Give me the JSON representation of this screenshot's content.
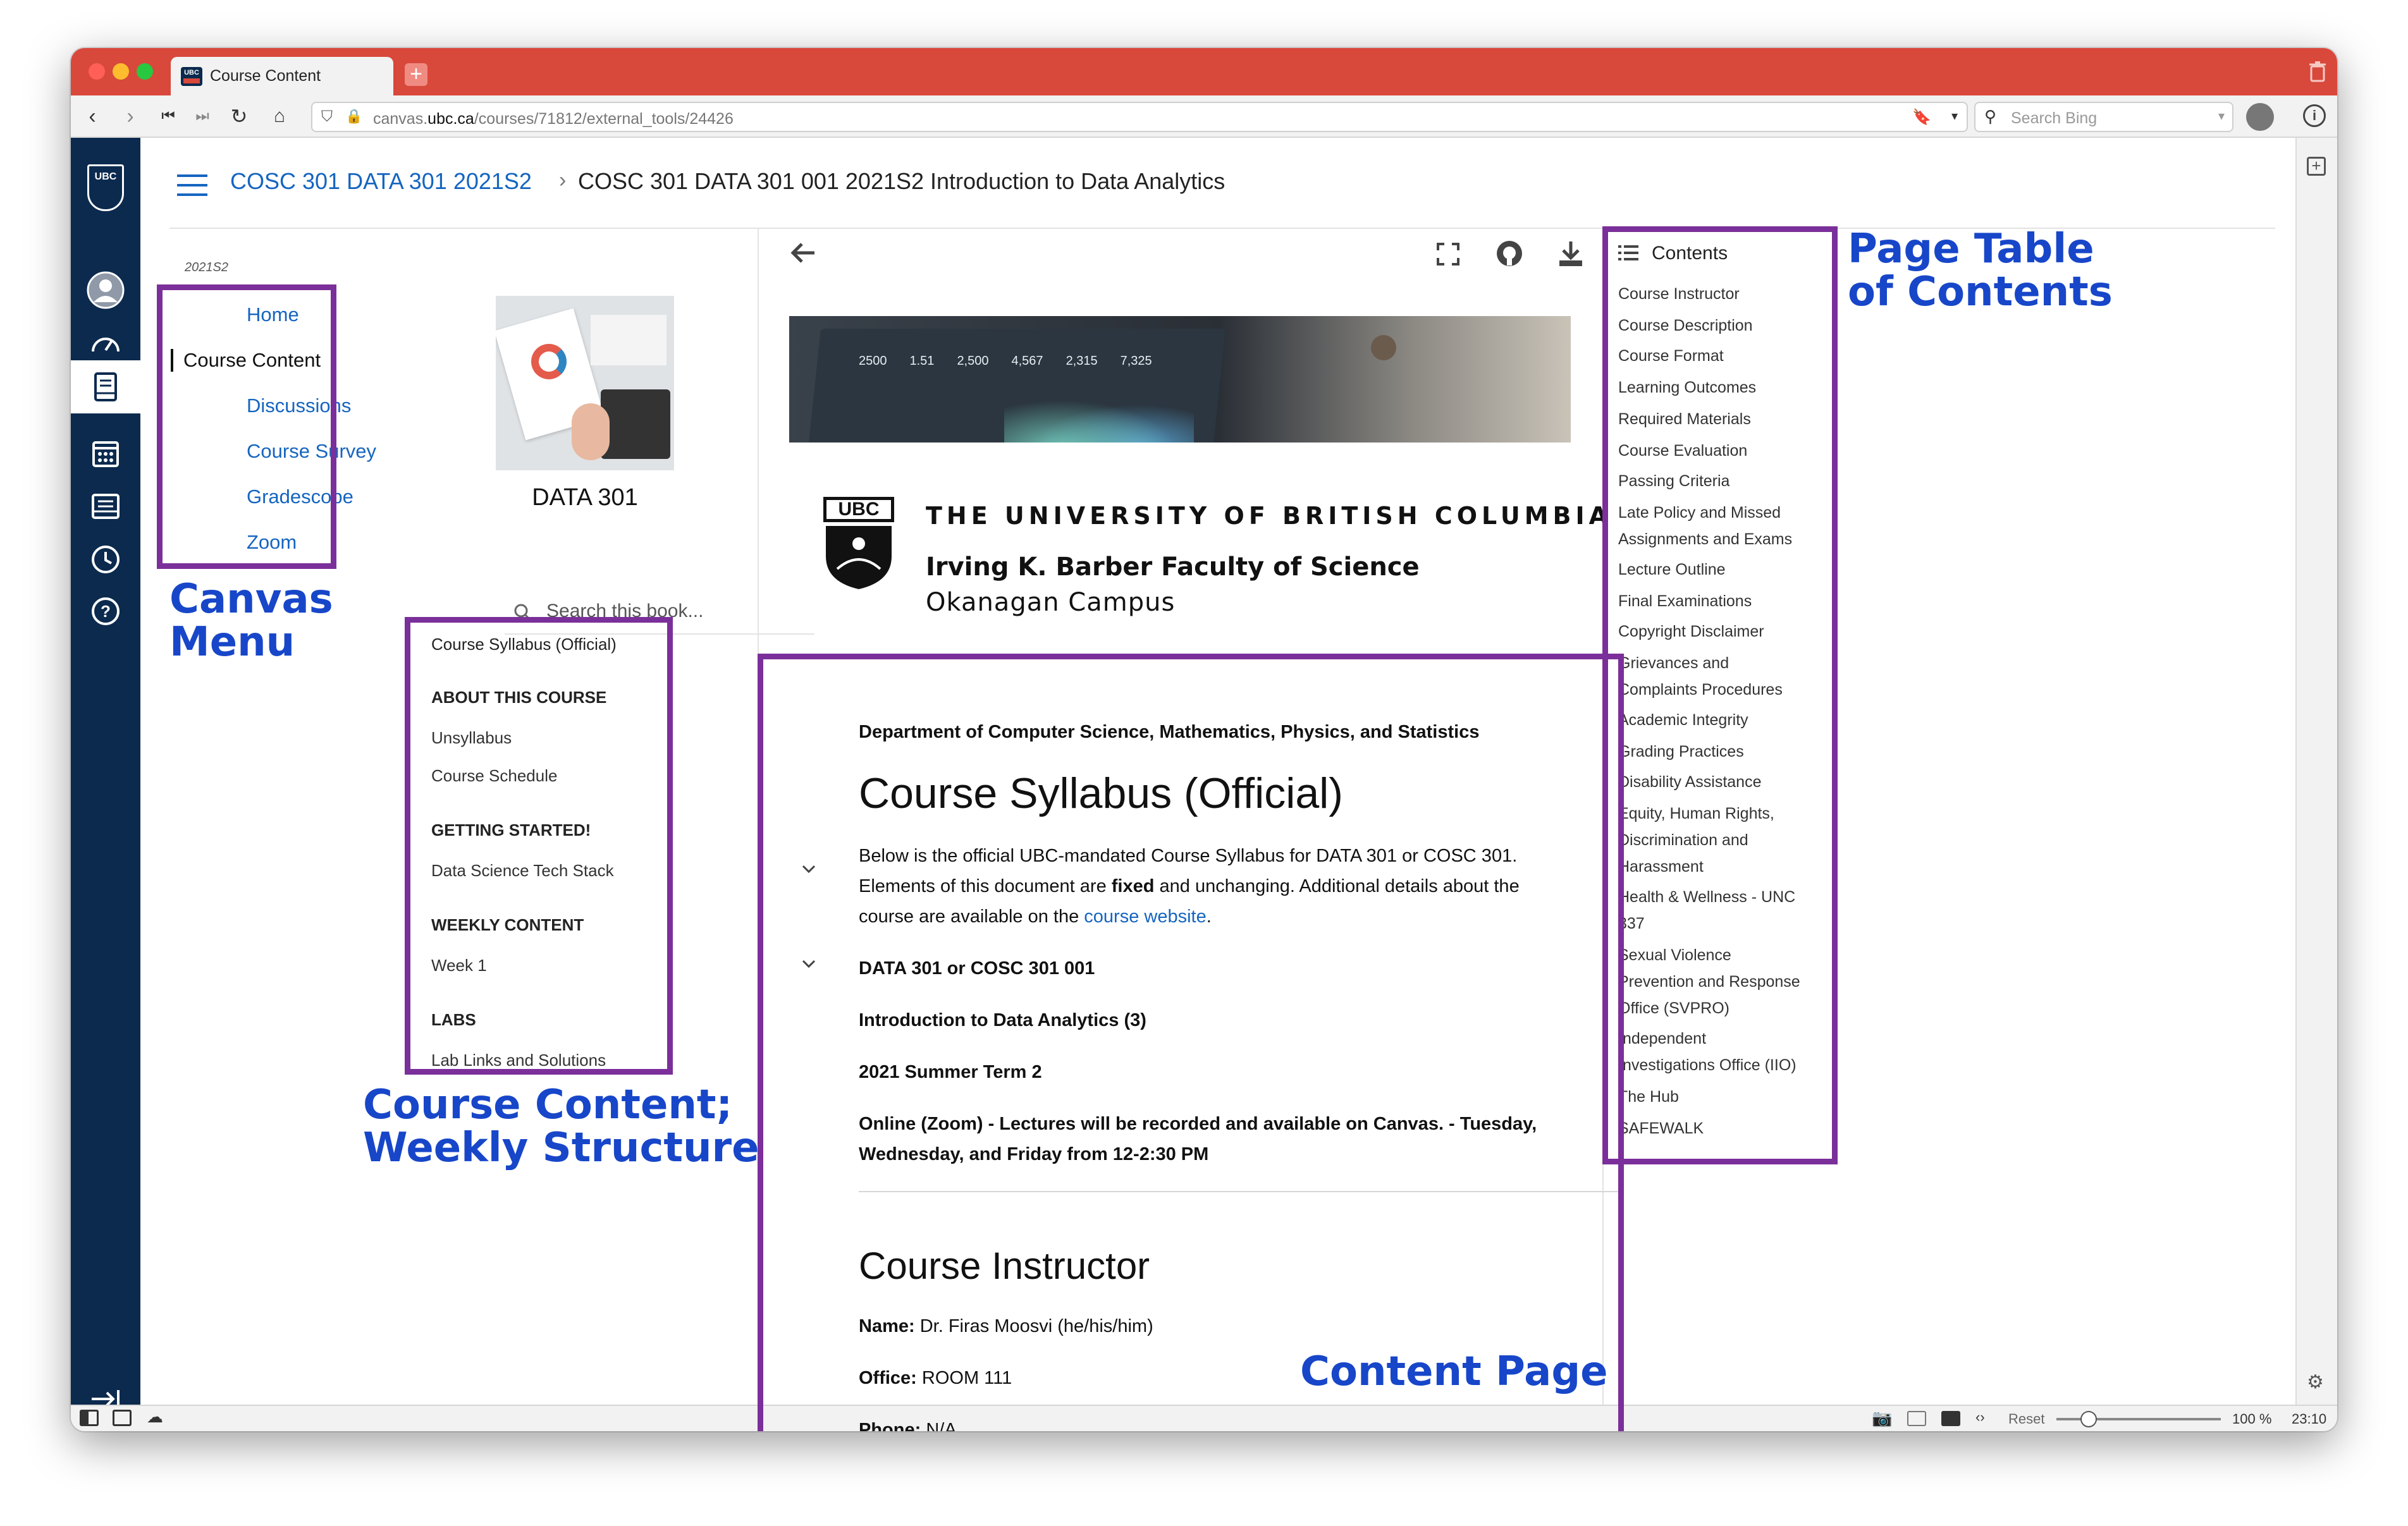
{
  "browser": {
    "tab_title": "Course Content",
    "url_prefix": "canvas.",
    "url_domain": "ubc.ca",
    "url_path": "/courses/71812/external_tools/24426",
    "search_placeholder": "Search Bing",
    "zoom": "100 %",
    "reset_label": "Reset",
    "clock": "23:10",
    "traffic_colors": [
      "#ff5f57",
      "#febc2e",
      "#28c840"
    ],
    "accent": "#d8483b"
  },
  "canvas": {
    "nav_color": "#0b2a4e",
    "logo_text": "UBC",
    "breadcrumb_course": "COSC 301 DATA 301 2021S2",
    "breadcrumb_separator": "›",
    "breadcrumb_page": "COSC 301 DATA 301 001 2021S2 Introduction to Data Analytics",
    "term": "2021S2",
    "menu": [
      "Home",
      "Course Content",
      "Discussions",
      "Course Survey",
      "Gradescope",
      "Zoom"
    ]
  },
  "book": {
    "title": "DATA 301",
    "search_placeholder": "Search this book...",
    "sections": [
      {
        "label": "Course Syllabus (Official)",
        "kind": "item"
      },
      {
        "label": "ABOUT THIS COURSE",
        "kind": "heading"
      },
      {
        "label": "Unsyllabus",
        "kind": "item"
      },
      {
        "label": "Course Schedule",
        "kind": "item"
      },
      {
        "label": "GETTING STARTED!",
        "kind": "heading"
      },
      {
        "label": "Data Science Tech Stack",
        "kind": "item",
        "expandable": true
      },
      {
        "label": "WEEKLY CONTENT",
        "kind": "heading"
      },
      {
        "label": "Week 1",
        "kind": "item",
        "expandable": true
      },
      {
        "label": "LABS",
        "kind": "heading"
      },
      {
        "label": "Lab Links and Solutions",
        "kind": "item"
      }
    ]
  },
  "toc": {
    "title": "Contents",
    "items": [
      [
        "Course Instructor"
      ],
      [
        "Course Description"
      ],
      [
        "Course Format"
      ],
      [
        "Learning Outcomes"
      ],
      [
        "Required Materials"
      ],
      [
        "Course Evaluation"
      ],
      [
        "Passing Criteria"
      ],
      [
        "Late Policy and Missed",
        "Assignments and Exams"
      ],
      [
        "Lecture Outline"
      ],
      [
        "Final Examinations"
      ],
      [
        "Copyright Disclaimer"
      ],
      [
        "Grievances and",
        "Complaints Procedures"
      ],
      [
        "Academic Integrity"
      ],
      [
        "Grading Practices"
      ],
      [
        "Disability Assistance"
      ],
      [
        "Equity, Human Rights,",
        "Discrimination and",
        "Harassment"
      ],
      [
        "Health & Wellness - UNC",
        "337"
      ],
      [
        "Sexual Violence",
        "Prevention and Response",
        "Office (SVPRO)"
      ],
      [
        "Independent",
        "Investigations Office (IIO)"
      ],
      [
        "The Hub"
      ],
      [
        "SAFEWALK"
      ]
    ]
  },
  "content": {
    "banner_numbers": [
      "2500",
      "1.51",
      "2,500",
      "4,567",
      "2,315",
      "7,325"
    ],
    "ubc_logo_text": "UBC",
    "university": "THE UNIVERSITY OF BRITISH COLUMBIA",
    "faculty": "Irving K. Barber Faculty of Science",
    "campus": "Okanagan Campus",
    "department": "Department of Computer Science, Mathematics, Physics, and Statistics",
    "heading": "Course Syllabus (Official)",
    "intro_1": "Below is the official UBC-mandated Course Syllabus for DATA 301 or COSC 301.",
    "intro_2_pre": "Elements of this document are ",
    "intro_2_bold": "fixed",
    "intro_2_post": " and unchanging. Additional details about the",
    "intro_3_pre": "course are available on the ",
    "intro_3_link": "course website",
    "intro_3_post": ".",
    "course_code": "DATA 301 or COSC 301 001",
    "course_name": "Introduction to Data Analytics (3)",
    "term": "2021 Summer Term 2",
    "delivery_1": "Online (Zoom) - Lectures will be recorded and available on Canvas. - Tuesday,",
    "delivery_2": "Wednesday, and Friday from 12-2:30 PM",
    "instructor_heading": "Course Instructor",
    "name_label": "Name:",
    "name_value": " Dr. Firas Moosvi (he/his/him)",
    "office_label": "Office:",
    "office_value": " ROOM 111",
    "phone_label": "Phone:",
    "phone_value": " N/A"
  },
  "annotations": {
    "color": "#1746c9",
    "box_color": "#7b2f9a",
    "canvas_menu": [
      "Canvas",
      "Menu"
    ],
    "course_content": [
      "Course Content;",
      "Weekly Structure"
    ],
    "page_toc": [
      "Page Table",
      "of Contents"
    ],
    "content_page": "Content Page"
  }
}
